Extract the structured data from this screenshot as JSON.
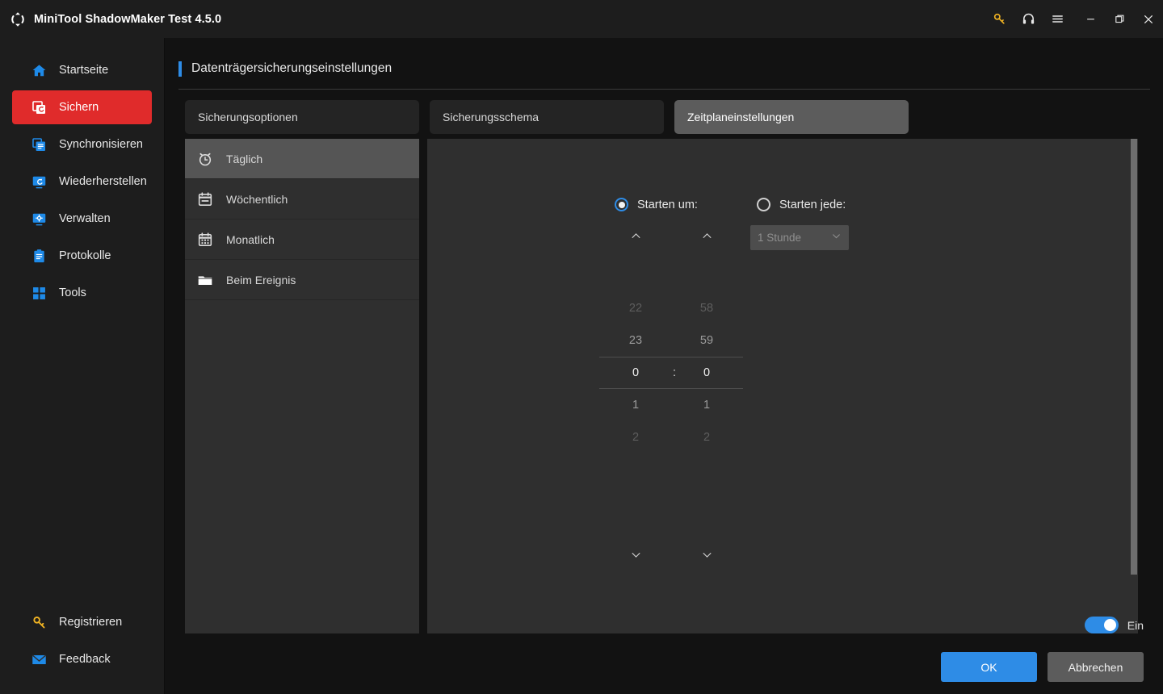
{
  "window": {
    "title": "MiniTool ShadowMaker Test 4.5.0",
    "logo_icon": "sync-circular-arrows-icon",
    "controls": [
      {
        "name": "key-icon",
        "label": "Registrieren"
      },
      {
        "name": "headset-icon",
        "label": "Support"
      },
      {
        "name": "hamburger-menu-icon",
        "label": "Menü"
      },
      {
        "name": "minimize-icon",
        "label": "Minimieren"
      },
      {
        "name": "maximize-icon",
        "label": "Maximieren"
      },
      {
        "name": "close-icon",
        "label": "Schließen"
      }
    ]
  },
  "sidebar": {
    "items": [
      {
        "label": "Startseite",
        "icon": "home-icon",
        "active": false
      },
      {
        "label": "Sichern",
        "icon": "backup-icon",
        "active": true
      },
      {
        "label": "Synchronisieren",
        "icon": "sync-icon",
        "active": false
      },
      {
        "label": "Wiederherstellen",
        "icon": "restore-icon",
        "active": false
      },
      {
        "label": "Verwalten",
        "icon": "manage-icon",
        "active": false
      },
      {
        "label": "Protokolle",
        "icon": "log-icon",
        "active": false
      },
      {
        "label": "Tools",
        "icon": "tools-icon",
        "active": false
      }
    ],
    "bottom_items": [
      {
        "label": "Registrieren",
        "icon": "key-icon"
      },
      {
        "label": "Feedback",
        "icon": "mail-icon"
      }
    ]
  },
  "page": {
    "title": "Datenträgersicherungseinstellungen",
    "accent_color": "#2e8ce6"
  },
  "tabs": [
    {
      "label": "Sicherungsoptionen",
      "active": false
    },
    {
      "label": "Sicherungsschema",
      "active": false
    },
    {
      "label": "Zeitplaneinstellungen",
      "active": true
    }
  ],
  "schedule_list": [
    {
      "label": "Täglich",
      "icon": "alarm-clock-icon",
      "selected": true
    },
    {
      "label": "Wöchentlich",
      "icon": "calendar-icon",
      "selected": false
    },
    {
      "label": "Monatlich",
      "icon": "calendar-grid-icon",
      "selected": false
    },
    {
      "label": "Beim Ereignis",
      "icon": "folder-icon",
      "selected": false
    }
  ],
  "daily": {
    "start_at": {
      "label": "Starten um:",
      "selected": true
    },
    "start_every": {
      "label": "Starten jede:",
      "selected": false
    },
    "interval_dropdown": {
      "value": "1 Stunde",
      "disabled": true,
      "chevron": "chevron-down-icon"
    },
    "time_picker": {
      "separator": ":",
      "hours": {
        "values": [
          "22",
          "23",
          "0",
          "1",
          "2"
        ],
        "selected_index": 2,
        "selected_value": "0"
      },
      "minutes": {
        "values": [
          "58",
          "59",
          "0",
          "1",
          "2"
        ],
        "selected_index": 2,
        "selected_value": "0"
      },
      "up_arrow_icon": "chevron-up-icon",
      "down_arrow_icon": "chevron-down-icon"
    }
  },
  "footer": {
    "toggle": {
      "label": "Ein",
      "on": true
    },
    "ok_label": "OK",
    "cancel_label": "Abbrechen"
  }
}
